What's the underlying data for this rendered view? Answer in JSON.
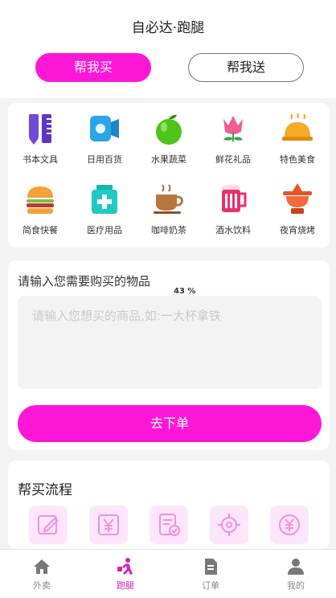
{
  "header": {
    "title": "自必达·跑腿"
  },
  "segments": {
    "buy": "帮我买",
    "send": "帮我送"
  },
  "categories": [
    {
      "label": "书本文具",
      "icon": "stationery-icon"
    },
    {
      "label": "日用百货",
      "icon": "tissue-roll-icon"
    },
    {
      "label": "水果蔬菜",
      "icon": "apple-icon"
    },
    {
      "label": "鲜花礼品",
      "icon": "flower-icon"
    },
    {
      "label": "特色美食",
      "icon": "food-cloche-icon"
    },
    {
      "label": "简食快餐",
      "icon": "burger-icon"
    },
    {
      "label": "医疗用品",
      "icon": "medicine-box-icon"
    },
    {
      "label": "咖啡奶茶",
      "icon": "coffee-cup-icon"
    },
    {
      "label": "酒水饮料",
      "icon": "beer-mug-icon"
    },
    {
      "label": "夜宵烧烤",
      "icon": "hotpot-icon"
    }
  ],
  "order": {
    "label": "请输入您需要购买的物品",
    "progress_text": "43 %",
    "placeholder": "请输入您想买的商品,如:一大杯拿铁",
    "submit": "去下单"
  },
  "flow": {
    "title": "帮买流程",
    "steps": [
      "edit-icon",
      "yuan-payment-icon",
      "order-check-icon",
      "locate-target-icon",
      "yuan-coin-icon"
    ]
  },
  "tabs": [
    {
      "label": "外卖",
      "icon": "home-icon",
      "active": false
    },
    {
      "label": "跑腿",
      "icon": "runner-icon",
      "active": true
    },
    {
      "label": "订单",
      "icon": "order-doc-icon",
      "active": false
    },
    {
      "label": "我的",
      "icon": "user-icon",
      "active": false
    }
  ],
  "colors": {
    "accent": "#ff17d8",
    "active_tab": "#d61ec0",
    "flow_bg": "#fde6fb"
  }
}
